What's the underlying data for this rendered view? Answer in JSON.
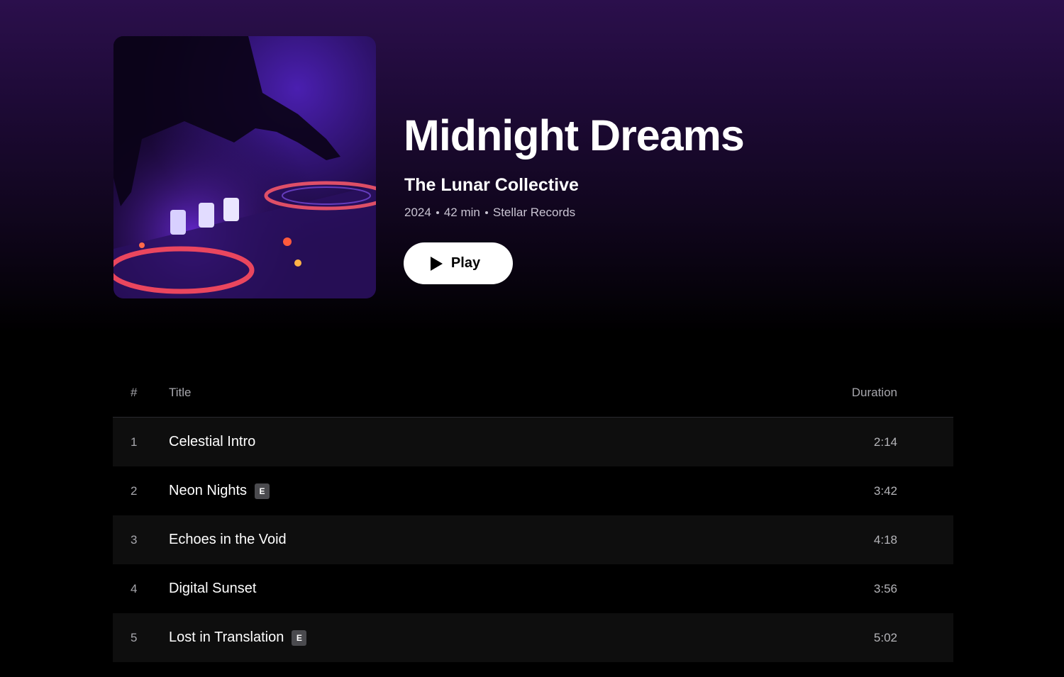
{
  "album": {
    "title": "Midnight Dreams",
    "artist": "The Lunar Collective",
    "year": "2024",
    "length": "42 min",
    "label": "Stellar Records",
    "cover_icon": "album-cover-dj-turntable"
  },
  "actions": {
    "play_label": "Play",
    "play_icon": "play-icon"
  },
  "table": {
    "headers": {
      "number": "#",
      "title": "Title",
      "duration": "Duration"
    },
    "tracks": [
      {
        "number": "1",
        "title": "Celestial Intro",
        "explicit": false,
        "duration": "2:14"
      },
      {
        "number": "2",
        "title": "Neon Nights",
        "explicit": true,
        "explicit_label": "E",
        "duration": "3:42"
      },
      {
        "number": "3",
        "title": "Echoes in the Void",
        "explicit": false,
        "duration": "4:18"
      },
      {
        "number": "4",
        "title": "Digital Sunset",
        "explicit": false,
        "duration": "3:56"
      },
      {
        "number": "5",
        "title": "Lost in Translation",
        "explicit": true,
        "explicit_label": "E",
        "duration": "5:02"
      }
    ]
  },
  "colors": {
    "header_gradient_top": "#2b0f4c",
    "background": "#000000",
    "row_alt": "#0e0e0e",
    "explicit_badge": "#4a4a4e"
  }
}
